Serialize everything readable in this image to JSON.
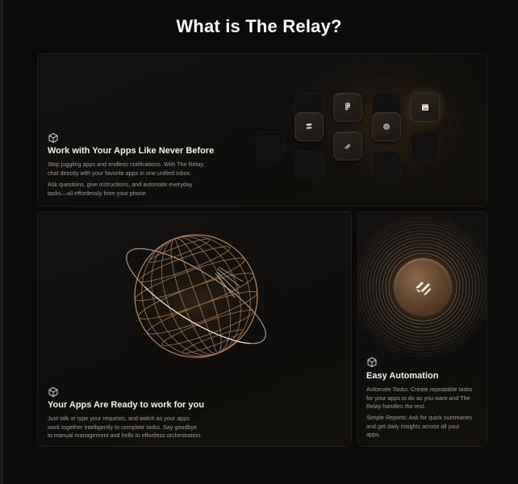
{
  "page": {
    "title": "What is The Relay?"
  },
  "cards": {
    "apps": {
      "icon": "cube-icon",
      "title": "Work with Your Apps Like Never Before",
      "paragraphs": [
        "Stop juggling apps and endless notifications. With The Relay,",
        "chat directly with your favorite apps in one unified inbox.",
        "Ask questions, give instructions, and automate everyday",
        "tasks—all effortlessly from your phone"
      ],
      "app_tiles": [
        "stack-icon",
        "figma-icon",
        "linear-icon",
        "openai-icon",
        "calendar-icon"
      ],
      "calendar_tile_text": "15"
    },
    "ready": {
      "icon": "cube-icon",
      "title": "Your Apps Are Ready to work for you",
      "lines": [
        " Just talk or type your requests, and watch as your apps",
        "work together intelligently to complete tasks. Say goodbye",
        "to manual management and hello to effortless orchestration."
      ]
    },
    "automation": {
      "icon": "cube-icon",
      "title": "Easy Automation",
      "lines": [
        "Automate Tasks: Create repeatable tasks",
        "for your apps to do as you want and The",
        "Relay handles the rest.",
        "Simple Reports: Ask for quick summaries",
        "and get daily insights across all your",
        "apps."
      ]
    }
  },
  "colors": {
    "background": "#0c0b0a",
    "accent": "#c9935e",
    "text_muted": "#a39c93"
  }
}
